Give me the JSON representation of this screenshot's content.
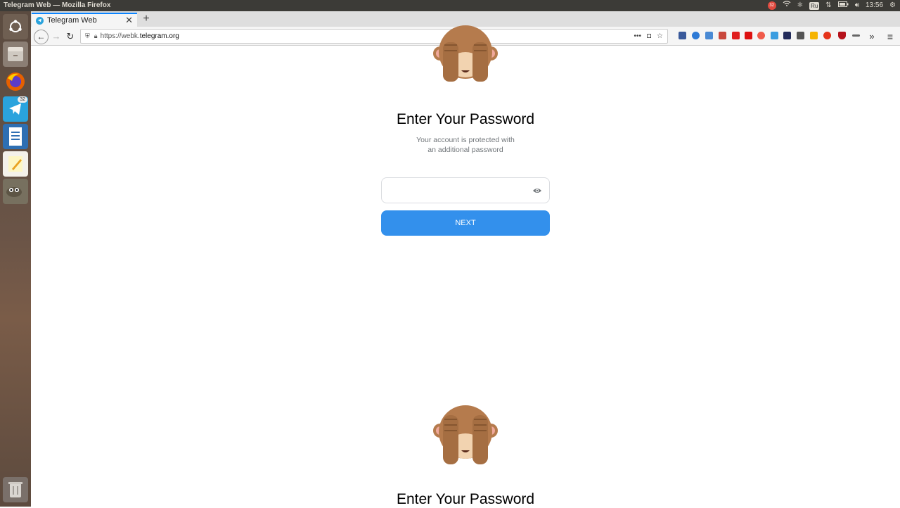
{
  "os": {
    "window_title": "Telegram Web — Mozilla Firefox",
    "notif_count": "32",
    "keyboard_layout": "Ru",
    "clock": "13:56",
    "launcher_telegram_badge": "32"
  },
  "browser": {
    "tab_title": "Telegram Web",
    "url_prefix": "https://webk.",
    "url_host": "telegram.org",
    "more_label": "•••"
  },
  "page": {
    "heading": "Enter Your Password",
    "subtitle_line1": "Your account is protected with",
    "subtitle_line2": "an additional password",
    "password_value": "",
    "next_label": "NEXT",
    "heading_repeat": "Enter Your Password"
  },
  "colors": {
    "accent": "#3390ec",
    "launcher_bg": "#5b4b40",
    "topbar_bg": "#3c3b37"
  }
}
